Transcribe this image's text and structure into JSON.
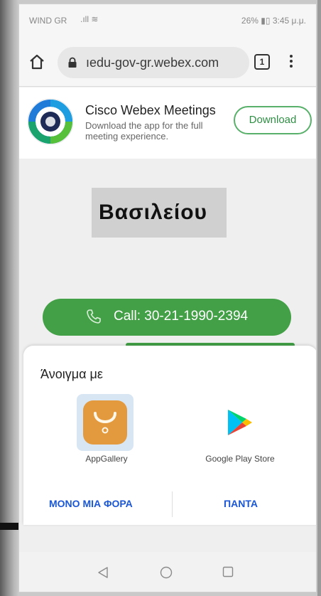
{
  "status": {
    "carrier": "WIND GR",
    "right": "26% ▮▯ 3:45 μ.μ."
  },
  "browser": {
    "url": "ıedu-gov-gr.webex.com",
    "tab_count": "1"
  },
  "banner": {
    "title": "Cisco Webex Meetings",
    "description": "Download the app for the full meeting experience.",
    "download_label": "Download"
  },
  "main": {
    "name": "Βασιλείου",
    "call_label": "Call: 30-21-1990-2394"
  },
  "sheet": {
    "title": "Άνοιγμα με",
    "apps": [
      {
        "label": "AppGallery",
        "icon": "appgallery-icon"
      },
      {
        "label": "Google Play Store",
        "icon": "google-play-icon"
      }
    ],
    "once_label": "ΜΟΝΟ ΜΙΑ ΦΟΡΑ",
    "always_label": "ΠΑΝΤΑ"
  },
  "colors": {
    "accent_green": "#43a047",
    "link_blue": "#1a56d6"
  }
}
